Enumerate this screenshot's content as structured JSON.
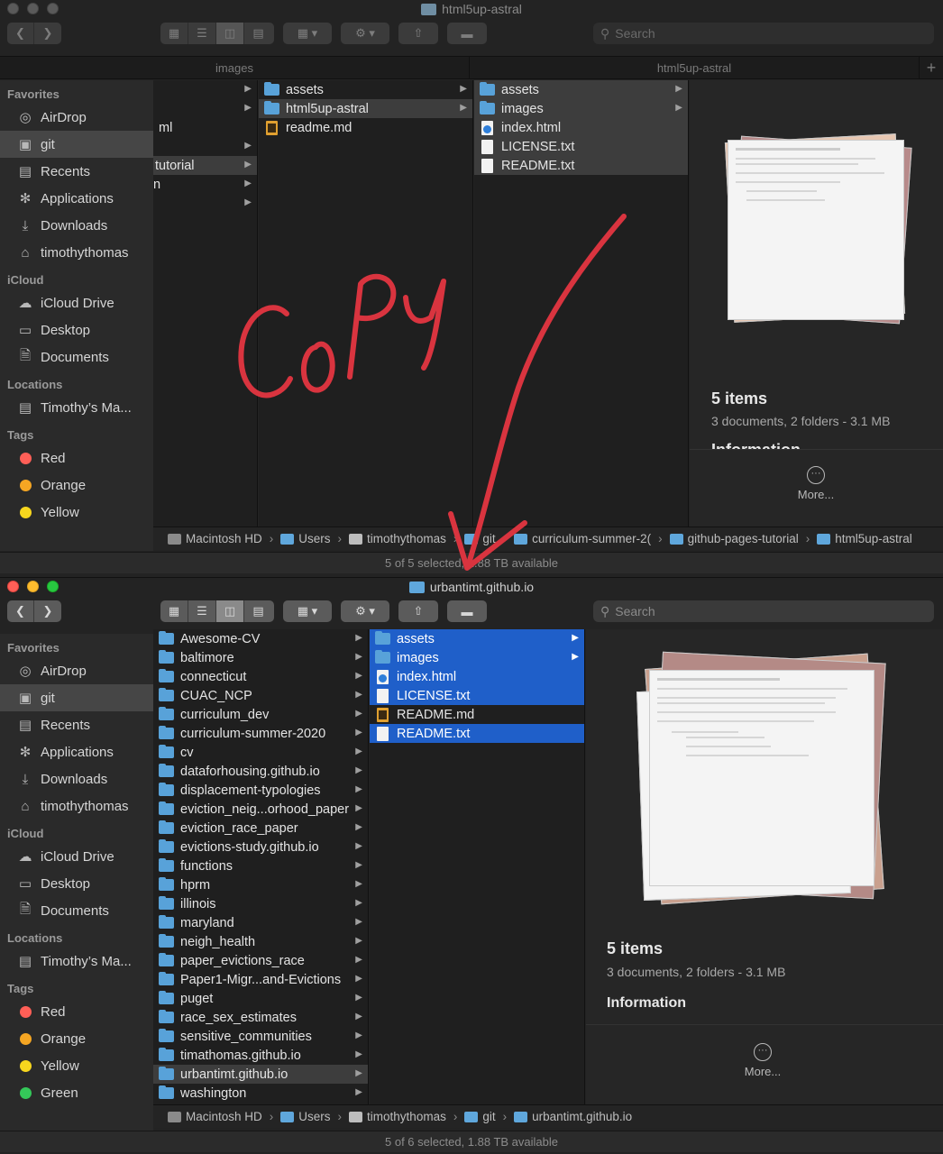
{
  "top_window": {
    "title": "html5up-astral",
    "search_placeholder": "Search",
    "tabs": [
      "images",
      "html5up-astral"
    ],
    "sidebar": {
      "favorites_heading": "Favorites",
      "favorites": [
        {
          "label": "AirDrop",
          "icon": "airdrop-icon"
        },
        {
          "label": "git",
          "icon": "folder-icon"
        },
        {
          "label": "Recents",
          "icon": "clock-icon"
        },
        {
          "label": "Applications",
          "icon": "applications-icon"
        },
        {
          "label": "Downloads",
          "icon": "download-icon"
        },
        {
          "label": "timothythomas",
          "icon": "home-icon"
        }
      ],
      "icloud_heading": "iCloud",
      "icloud": [
        {
          "label": "iCloud Drive",
          "icon": "cloud-icon"
        },
        {
          "label": "Desktop",
          "icon": "desktop-icon"
        },
        {
          "label": "Documents",
          "icon": "document-icon"
        }
      ],
      "locations_heading": "Locations",
      "locations": [
        {
          "label": "Timothy’s Ma...",
          "icon": "laptop-icon"
        }
      ],
      "tags_heading": "Tags",
      "tags": [
        {
          "label": "Red",
          "color": "#ff5f57"
        },
        {
          "label": "Orange",
          "color": "#f5a623"
        },
        {
          "label": "Yellow",
          "color": "#f7d61e"
        }
      ]
    },
    "col1_fragments": [
      "ml",
      "tutorial",
      "n"
    ],
    "col2": [
      {
        "label": "assets",
        "kind": "folder"
      },
      {
        "label": "html5up-astral",
        "kind": "folder"
      },
      {
        "label": "readme.md",
        "kind": "md"
      }
    ],
    "col3": [
      {
        "label": "assets",
        "kind": "folder"
      },
      {
        "label": "images",
        "kind": "folder"
      },
      {
        "label": "index.html",
        "kind": "html"
      },
      {
        "label": "LICENSE.txt",
        "kind": "txt"
      },
      {
        "label": "README.txt",
        "kind": "txt"
      }
    ],
    "preview": {
      "items_title": "5 items",
      "items_sub": "3 documents, 2 folders - 3.1 MB",
      "info_partial": "Information",
      "more_label": "More..."
    },
    "pathbar": [
      "Macintosh HD",
      "Users",
      "timothythomas",
      "git",
      "curriculum-summer-2(",
      "github-pages-tutorial",
      "html5up-astral"
    ],
    "status": "5 of 5 selected, 1.88 TB available"
  },
  "annotation": {
    "text": "Copy",
    "color": "#d9343f"
  },
  "bottom_window": {
    "title": "urbantimt.github.io",
    "search_placeholder": "Search",
    "sidebar": {
      "favorites_heading": "Favorites",
      "favorites": [
        {
          "label": "AirDrop",
          "icon": "airdrop-icon"
        },
        {
          "label": "git",
          "icon": "folder-icon"
        },
        {
          "label": "Recents",
          "icon": "clock-icon"
        },
        {
          "label": "Applications",
          "icon": "applications-icon"
        },
        {
          "label": "Downloads",
          "icon": "download-icon"
        },
        {
          "label": "timothythomas",
          "icon": "home-icon"
        }
      ],
      "icloud_heading": "iCloud",
      "icloud": [
        {
          "label": "iCloud Drive",
          "icon": "cloud-icon"
        },
        {
          "label": "Desktop",
          "icon": "desktop-icon"
        },
        {
          "label": "Documents",
          "icon": "document-icon"
        }
      ],
      "locations_heading": "Locations",
      "locations": [
        {
          "label": "Timothy’s Ma...",
          "icon": "laptop-icon"
        }
      ],
      "tags_heading": "Tags",
      "tags": [
        {
          "label": "Red",
          "color": "#ff5f57"
        },
        {
          "label": "Orange",
          "color": "#f5a623"
        },
        {
          "label": "Yellow",
          "color": "#f7d61e"
        },
        {
          "label": "Green",
          "color": "#34c759"
        }
      ]
    },
    "col1": [
      "Awesome-CV",
      "baltimore",
      "connecticut",
      "CUAC_NCP",
      "curriculum_dev",
      "curriculum-summer-2020",
      "cv",
      "dataforhousing.github.io",
      "displacement-typologies",
      "eviction_neig...orhood_paper",
      "eviction_race_paper",
      "evictions-study.github.io",
      "functions",
      "hprm",
      "illinois",
      "maryland",
      "neigh_health",
      "paper_evictions_race",
      "Paper1-Migr...and-Evictions",
      "puget",
      "race_sex_estimates",
      "sensitive_communities",
      "timathomas.github.io",
      "urbantimt.github.io",
      "washington"
    ],
    "col1_selected": "urbantimt.github.io",
    "col2": [
      {
        "label": "assets",
        "kind": "folder",
        "selected": true
      },
      {
        "label": "images",
        "kind": "folder",
        "selected": true
      },
      {
        "label": "index.html",
        "kind": "html",
        "selected": true
      },
      {
        "label": "LICENSE.txt",
        "kind": "txt",
        "selected": true
      },
      {
        "label": "README.md",
        "kind": "md",
        "selected": false
      },
      {
        "label": "README.txt",
        "kind": "txt",
        "selected": true
      }
    ],
    "preview": {
      "items_title": "5 items",
      "items_sub": "3 documents, 2 folders - 3.1 MB",
      "info_title": "Information",
      "more_label": "More..."
    },
    "pathbar": [
      "Macintosh HD",
      "Users",
      "timothythomas",
      "git",
      "urbantimt.github.io"
    ],
    "status": "5 of 6 selected, 1.88 TB available"
  }
}
